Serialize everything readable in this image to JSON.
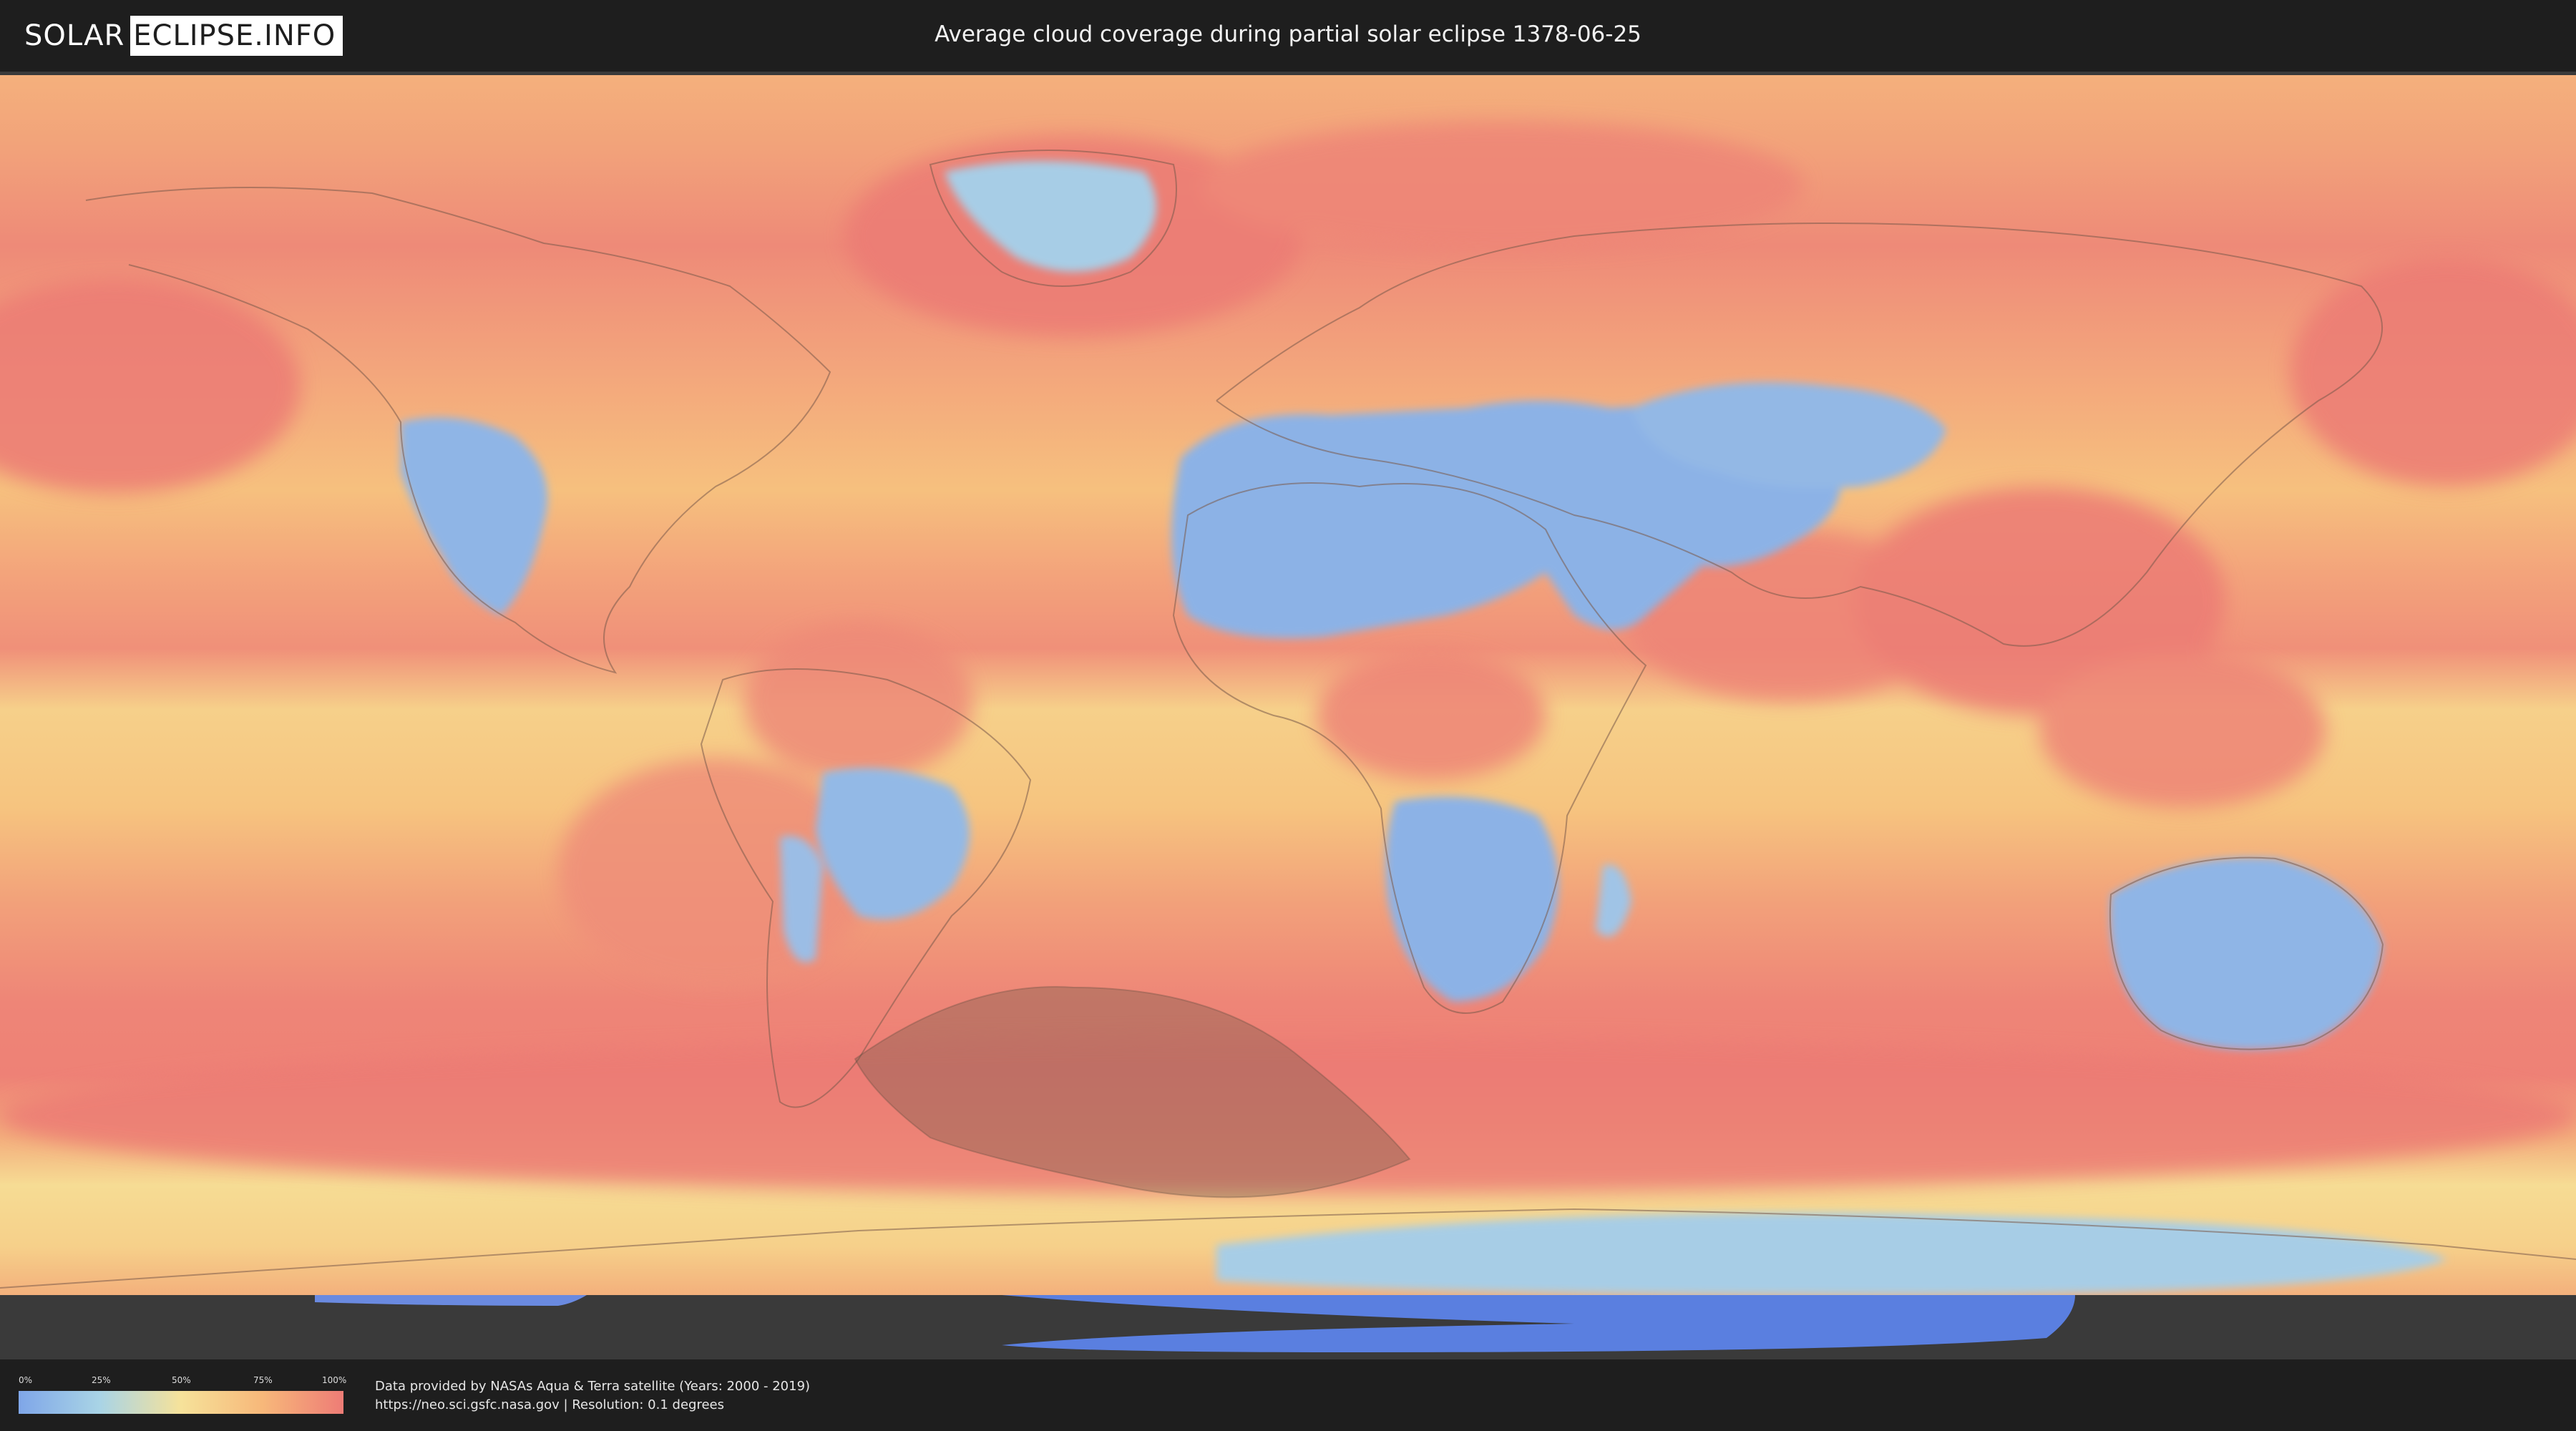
{
  "logo": {
    "left_text": "SOLAR",
    "right_text": "ECLIPSE.INFO"
  },
  "header": {
    "title": "Average cloud coverage during partial solar eclipse 1378-06-25"
  },
  "legend": {
    "ticks": [
      "0%",
      "25%",
      "50%",
      "75%",
      "100%"
    ],
    "colors": [
      "#7fa6e8",
      "#a9d4e6",
      "#f6e29a",
      "#f7b87a",
      "#ee7c76"
    ]
  },
  "footer": {
    "credit_line1": "Data provided by NASAs Aqua & Terra satellite (Years: 2000 - 2019)",
    "credit_line2": "https://neo.sci.gsfc.nasa.gov | Resolution: 0.1 degrees"
  },
  "map_colors": {
    "ocean_cloudy": "#ee8377",
    "mid_cloud": "#f6c17d",
    "low_cloud": "#f6e29a",
    "clear": "#89b2e6",
    "eclipse_shadow": "#6e5a48",
    "antarctic_ice": "#5a7fe0"
  }
}
